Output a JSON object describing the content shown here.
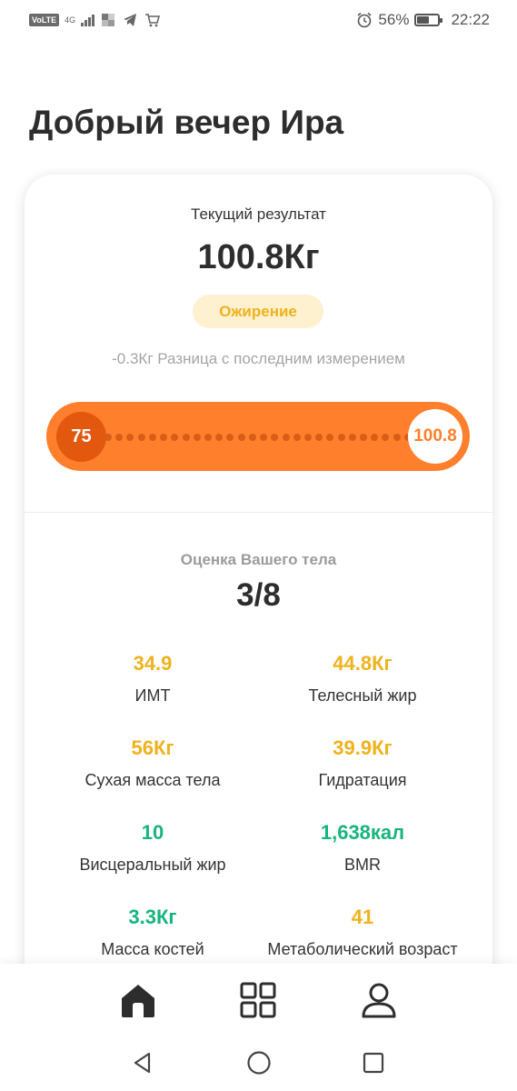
{
  "status_bar": {
    "volte": "VoLTE",
    "network": "4G",
    "battery": "56%",
    "battery_level": 0.56,
    "time": "22:22"
  },
  "greeting": "Добрый вечер Ира",
  "current": {
    "label": "Текущий результат",
    "weight": "100.8Кг",
    "status_badge": "Ожирение",
    "difference": "-0.3Кг Разница с последним измерением",
    "range_start": "75",
    "range_end": "100.8"
  },
  "body_score": {
    "label": "Оценка Вашего тела",
    "value": "3/8"
  },
  "metrics": [
    {
      "value": "34.9",
      "label": "ИМТ",
      "color": "yellow"
    },
    {
      "value": "44.8Кг",
      "label": "Телесный жир",
      "color": "yellow"
    },
    {
      "value": "56Кг",
      "label": "Сухая масса тела",
      "color": "yellow"
    },
    {
      "value": "39.9Кг",
      "label": "Гидратация",
      "color": "yellow"
    },
    {
      "value": "10",
      "label": "Висцеральный жир",
      "color": "green"
    },
    {
      "value": "1,638кал",
      "label": "BMR",
      "color": "green"
    },
    {
      "value": "3.3Кг",
      "label": "Масса костей",
      "color": "green"
    },
    {
      "value": "41",
      "label": "Метаболический возраст",
      "color": "yellow"
    }
  ],
  "colors": {
    "accent_orange": "#ff7f2c",
    "warning_yellow": "#f0b21d",
    "good_green": "#17b57d"
  },
  "bottom_nav": [
    "home-icon",
    "grid-icon",
    "user-icon"
  ],
  "system_nav": [
    "back-icon",
    "home-circle-icon",
    "recents-icon"
  ]
}
